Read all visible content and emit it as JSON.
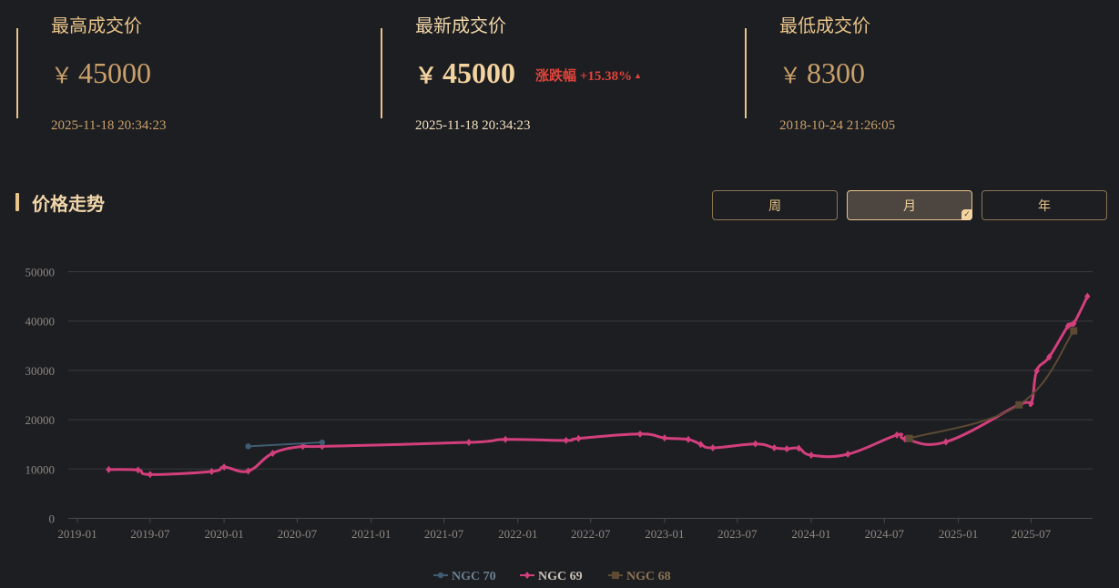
{
  "stats": {
    "highest": {
      "label": "最高成交价",
      "currency": "￥",
      "value": "45000",
      "time": "2025-11-18 20:34:23"
    },
    "latest": {
      "label": "最新成交价",
      "currency": "￥",
      "value": "45000",
      "time": "2025-11-18 20:34:23",
      "change_label": "涨跌幅",
      "change_value": "+15.38%",
      "change_arrow": "▲"
    },
    "lowest": {
      "label": "最低成交价",
      "currency": "￥",
      "value": "8300",
      "time": "2018-10-24 21:26:05"
    }
  },
  "section": {
    "title": "价格走势"
  },
  "tabs": [
    {
      "label": "周",
      "active": false
    },
    {
      "label": "月",
      "active": true
    },
    {
      "label": "年",
      "active": false
    }
  ],
  "colors": {
    "accent": "#e8c48a",
    "ngc70": "#3f5c73",
    "ngc69": "#d23f7c",
    "ngc68": "#5c4a33",
    "up": "#e0433a"
  },
  "chart_data": {
    "type": "line",
    "x_ticks": [
      "2019-01",
      "2019-07",
      "2020-01",
      "2020-07",
      "2021-01",
      "2021-07",
      "2022-01",
      "2022-07",
      "2023-01",
      "2023-07",
      "2024-01",
      "2024-07",
      "2025-01",
      "2025-07"
    ],
    "y_ticks": [
      0,
      10000,
      20000,
      30000,
      40000,
      50000
    ],
    "ylim": [
      0,
      50000
    ],
    "xlim": [
      "2019-01",
      "2025-12"
    ],
    "grid": true,
    "legend": "bottom-center",
    "series": [
      {
        "name": "NGC 70",
        "marker": "circle",
        "smooth": false,
        "points": [
          [
            "2020-03-01",
            14600
          ],
          [
            "2020-09-01",
            15400
          ]
        ]
      },
      {
        "name": "NGC 69",
        "marker": "diamond",
        "smooth": true,
        "points": [
          [
            "2019-03-20",
            9900
          ],
          [
            "2019-06-01",
            9800
          ],
          [
            "2019-07-01",
            8900
          ],
          [
            "2019-12-01",
            9500
          ],
          [
            "2020-01-01",
            10400
          ],
          [
            "2020-03-01",
            9600
          ],
          [
            "2020-05-01",
            13200
          ],
          [
            "2020-07-15",
            14600
          ],
          [
            "2020-09-01",
            14600
          ],
          [
            "2021-09-01",
            15400
          ],
          [
            "2021-12-01",
            16000
          ],
          [
            "2022-05-01",
            15800
          ],
          [
            "2022-06-01",
            16200
          ],
          [
            "2022-11-01",
            17100
          ],
          [
            "2023-01-01",
            16300
          ],
          [
            "2023-03-01",
            16000
          ],
          [
            "2023-04-01",
            15000
          ],
          [
            "2023-05-01",
            14300
          ],
          [
            "2023-08-15",
            15100
          ],
          [
            "2023-10-01",
            14300
          ],
          [
            "2023-11-01",
            14100
          ],
          [
            "2023-12-01",
            14200
          ],
          [
            "2024-01-01",
            12800
          ],
          [
            "2024-04-01",
            13000
          ],
          [
            "2024-08-01",
            16900
          ],
          [
            "2024-08-21",
            16100
          ],
          [
            "2024-12-01",
            15500
          ],
          [
            "2025-06-01",
            23000
          ],
          [
            "2025-07-01",
            23300
          ],
          [
            "2025-07-15",
            29900
          ],
          [
            "2025-08-15",
            32700
          ],
          [
            "2025-10-01",
            39000
          ],
          [
            "2025-10-15",
            39500
          ],
          [
            "2025-11-18",
            45000
          ]
        ]
      },
      {
        "name": "NGC 68",
        "marker": "square",
        "smooth": true,
        "points": [
          [
            "2024-09-01",
            16200
          ],
          [
            "2025-06-01",
            23000
          ],
          [
            "2025-10-15",
            38000
          ]
        ]
      }
    ]
  }
}
